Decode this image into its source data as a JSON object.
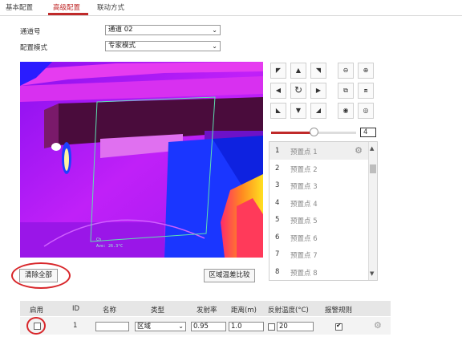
{
  "tabs": [
    "基本配置",
    "高级配置",
    "联动方式"
  ],
  "form": {
    "channel_label": "通道号",
    "channel_value": "通道 02",
    "mode_label": "配置模式",
    "mode_value": "专家模式"
  },
  "video": {
    "overlay_line1": "Ch",
    "overlay_line2": "Ave: 26.3°C"
  },
  "ptz": {
    "speed_value": "4",
    "speed_level": 0.5
  },
  "presets": {
    "items": [
      {
        "num": "1",
        "name": "预置点 1"
      },
      {
        "num": "2",
        "name": "预置点 2"
      },
      {
        "num": "3",
        "name": "预置点 3"
      },
      {
        "num": "4",
        "name": "预置点 4"
      },
      {
        "num": "5",
        "name": "预置点 5"
      },
      {
        "num": "6",
        "name": "预置点 6"
      },
      {
        "num": "7",
        "name": "预置点 7"
      },
      {
        "num": "8",
        "name": "预置点 8"
      }
    ]
  },
  "buttons": {
    "clear_all": "清除全部",
    "compare": "区域温差比较"
  },
  "table": {
    "headers": [
      "启用",
      "ID",
      "名称",
      "类型",
      "发射率",
      "距离(m)",
      "反射温度(°C)",
      "报警规则"
    ],
    "row": {
      "id": "1",
      "name": "",
      "type": "区域",
      "emissivity": "0.95",
      "distance": "1.0",
      "reflect_temp": "20"
    }
  },
  "colors": {
    "accent": "#c02a2a",
    "annotation_ring": "#d8262a"
  }
}
